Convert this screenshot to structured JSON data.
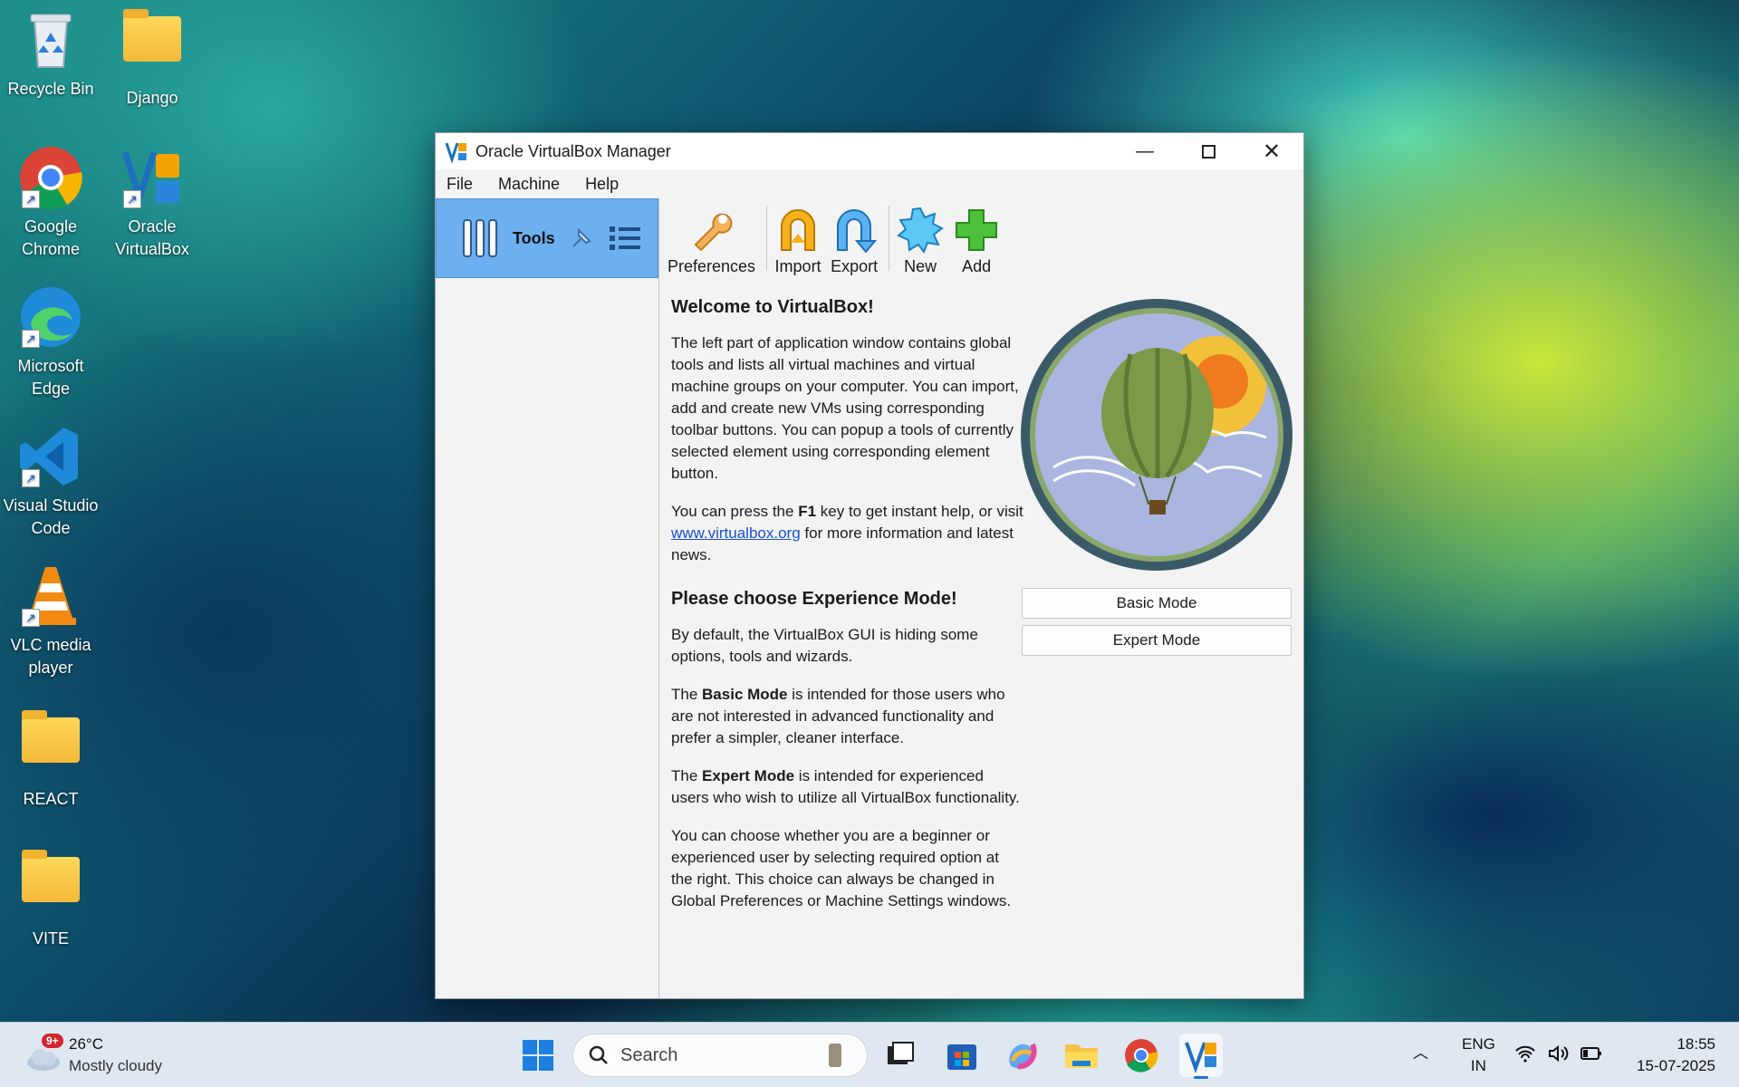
{
  "desktop": {
    "icons": [
      {
        "label": "Recycle Bin"
      },
      {
        "label": "Django"
      },
      {
        "label": "Google Chrome"
      },
      {
        "label": "Oracle VirtualBox"
      },
      {
        "label": "Microsoft Edge"
      },
      {
        "label": "Visual Studio Code"
      },
      {
        "label": "VLC media player"
      },
      {
        "label": "REACT"
      },
      {
        "label": "VITE"
      }
    ]
  },
  "window": {
    "title": "Oracle VirtualBox Manager",
    "menu": [
      "File",
      "Machine",
      "Help"
    ],
    "left_pane": {
      "tools_label": "Tools"
    },
    "toolbar": [
      {
        "label": "Preferences",
        "icon": "wrench-icon"
      },
      {
        "label": "Import",
        "icon": "import-arrow-icon"
      },
      {
        "label": "Export",
        "icon": "export-arrow-icon"
      },
      {
        "label": "New",
        "icon": "new-vm-star-icon"
      },
      {
        "label": "Add",
        "icon": "add-plus-icon"
      }
    ],
    "welcome": {
      "heading": "Welcome to VirtualBox!",
      "p1": "The left part of application window contains global tools and lists all virtual machines and virtual machine groups on your computer. You can import, add and create new VMs using corresponding toolbar buttons. You can popup a tools of currently selected element using corresponding element button.",
      "p2_pre": "You can press the ",
      "p2_key": "F1",
      "p2_mid": " key to get instant help, or visit ",
      "p2_link": "www.virtualbox.org",
      "p2_post": " for more information and latest news."
    },
    "experience": {
      "heading": "Please choose Experience Mode!",
      "p1": "By default, the VirtualBox GUI is hiding some options, tools and wizards.",
      "p2_pre": "The ",
      "p2_bold": "Basic Mode",
      "p2_post": " is intended for those users who are not interested in advanced functionality and prefer a simpler, cleaner interface.",
      "p3_pre": "The ",
      "p3_bold": "Expert Mode",
      "p3_post": " is intended for experienced users who wish to utilize all VirtualBox functionality.",
      "p4": "You can choose whether you are a beginner or experienced user by selecting required option at the right. This choice can always be changed in Global Preferences or Machine Settings windows.",
      "basic_button": "Basic Mode",
      "expert_button": "Expert Mode"
    }
  },
  "taskbar": {
    "weather_badge": "9+",
    "temperature": "26°C",
    "condition": "Mostly cloudy",
    "search_placeholder": "Search",
    "lang_top": "ENG",
    "lang_bottom": "IN",
    "time": "18:55",
    "date": "15-07-2025"
  }
}
